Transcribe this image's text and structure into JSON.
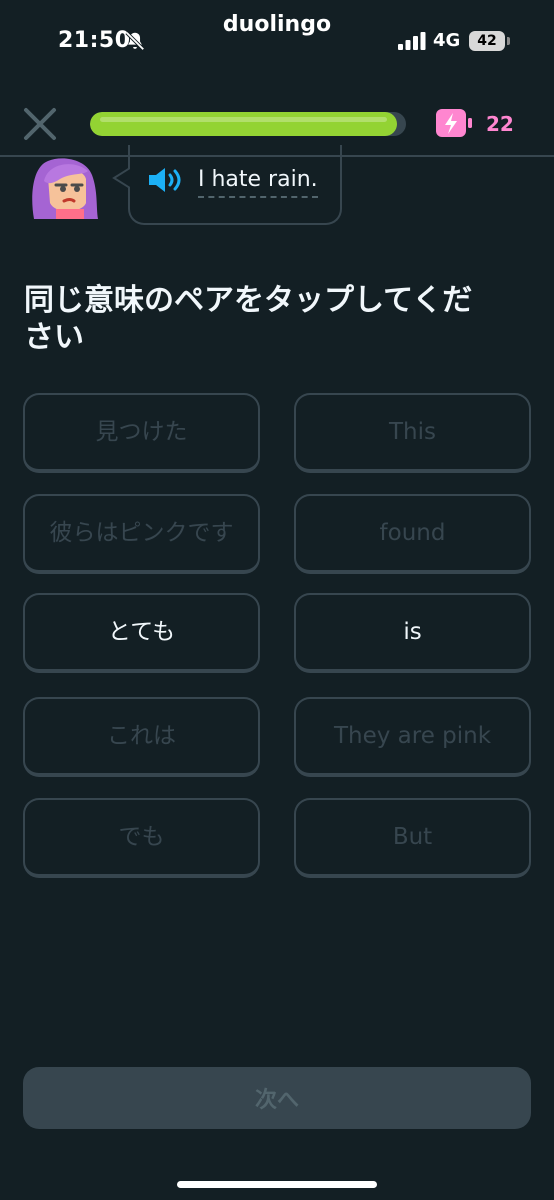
{
  "status_bar": {
    "time": "21:50",
    "app_label": "duolingo",
    "network": "4G",
    "battery": "42"
  },
  "header": {
    "progress_percent": 97,
    "energy_count": "22",
    "colors": {
      "progress": "#93d333",
      "energy": "#ff86d0"
    }
  },
  "speech": {
    "sentence": "I hate rain."
  },
  "prompt": "同じ意味のペアをタップしてください",
  "pairs": {
    "left": [
      {
        "label": "見つけた",
        "state": "matched"
      },
      {
        "label": "彼らはピンクです",
        "state": "matched"
      },
      {
        "label": "とても",
        "state": "active"
      },
      {
        "label": "これは",
        "state": "matched"
      },
      {
        "label": "でも",
        "state": "matched"
      }
    ],
    "right": [
      {
        "label": "This",
        "state": "matched"
      },
      {
        "label": "found",
        "state": "matched"
      },
      {
        "label": "is",
        "state": "active"
      },
      {
        "label": "They are pink",
        "state": "matched"
      },
      {
        "label": "But",
        "state": "matched"
      }
    ]
  },
  "footer": {
    "next_label": "次へ"
  },
  "icons": [
    "bell-slash-icon",
    "signal-icon",
    "close-icon",
    "energy-icon",
    "speaker-icon"
  ]
}
